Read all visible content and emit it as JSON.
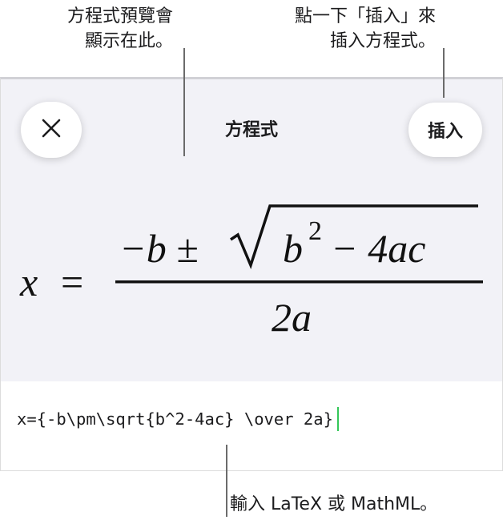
{
  "callouts": {
    "preview_line1": "方程式預覽會",
    "preview_line2": "顯示在此。",
    "insert_line1": "點一下「插入」來",
    "insert_line2": "插入方程式。",
    "input": "輸入 LaTeX 或 MathML。"
  },
  "sheet": {
    "title": "方程式",
    "close_icon": "close-icon",
    "insert_label": "插入"
  },
  "equation_preview": {
    "lhs": "x",
    "equals": "=",
    "numerator_prefix": "−b ±",
    "radicand_base": "b",
    "radicand_exponent": "2",
    "radicand_rest": "− 4ac",
    "denominator": "2a"
  },
  "input": {
    "value": "x={-b\\pm\\sqrt{b^2-4ac} \\over 2a}"
  },
  "colors": {
    "accent_caret": "#34c759",
    "sheet_bg": "#f2f2f7"
  }
}
